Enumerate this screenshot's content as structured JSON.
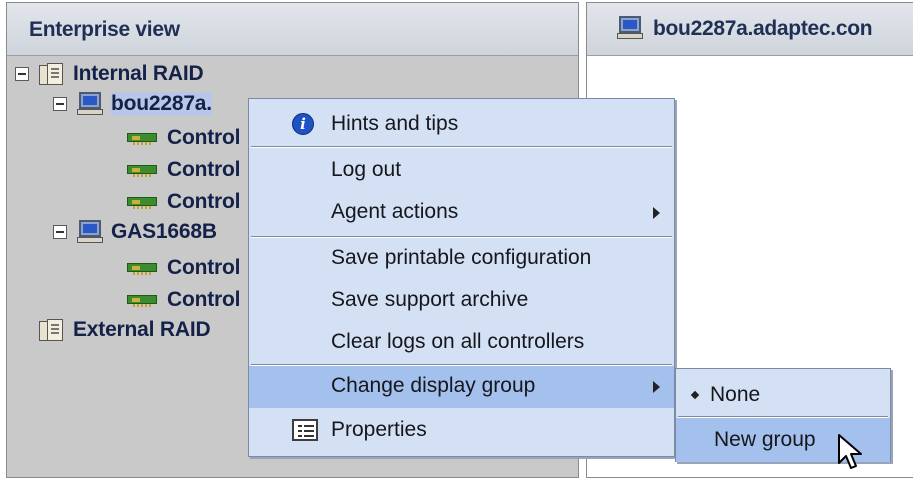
{
  "left_panel": {
    "header": "Enterprise view",
    "tree": {
      "internal_raid": "Internal RAID",
      "host1": "bou2287a.",
      "host1_controllers": [
        "Control",
        "Control",
        "Control"
      ],
      "host2": "GAS1668B",
      "host2_controllers": [
        "Control",
        "Control"
      ],
      "external_raid": "External RAID"
    }
  },
  "right_panel": {
    "header": "bou2287a.adaptec.con"
  },
  "context_menu": {
    "items": [
      {
        "label": "Hints and tips",
        "icon": "info-icon"
      },
      {
        "label": "Log out"
      },
      {
        "label": "Agent actions",
        "submenu": true
      },
      {
        "label": "Save printable configuration"
      },
      {
        "label": "Save support archive"
      },
      {
        "label": "Clear logs on all controllers"
      },
      {
        "label": "Change display group",
        "submenu": true,
        "highlighted": true
      },
      {
        "label": "Properties",
        "icon": "properties-icon"
      }
    ]
  },
  "submenu": {
    "items": [
      {
        "label": "None",
        "selected": true
      },
      {
        "label": "New group",
        "highlighted": true
      }
    ]
  },
  "colors": {
    "menu_bg": "#d4e0f4",
    "highlight": "#a4c0ec",
    "header_text": "#1f2f56"
  }
}
